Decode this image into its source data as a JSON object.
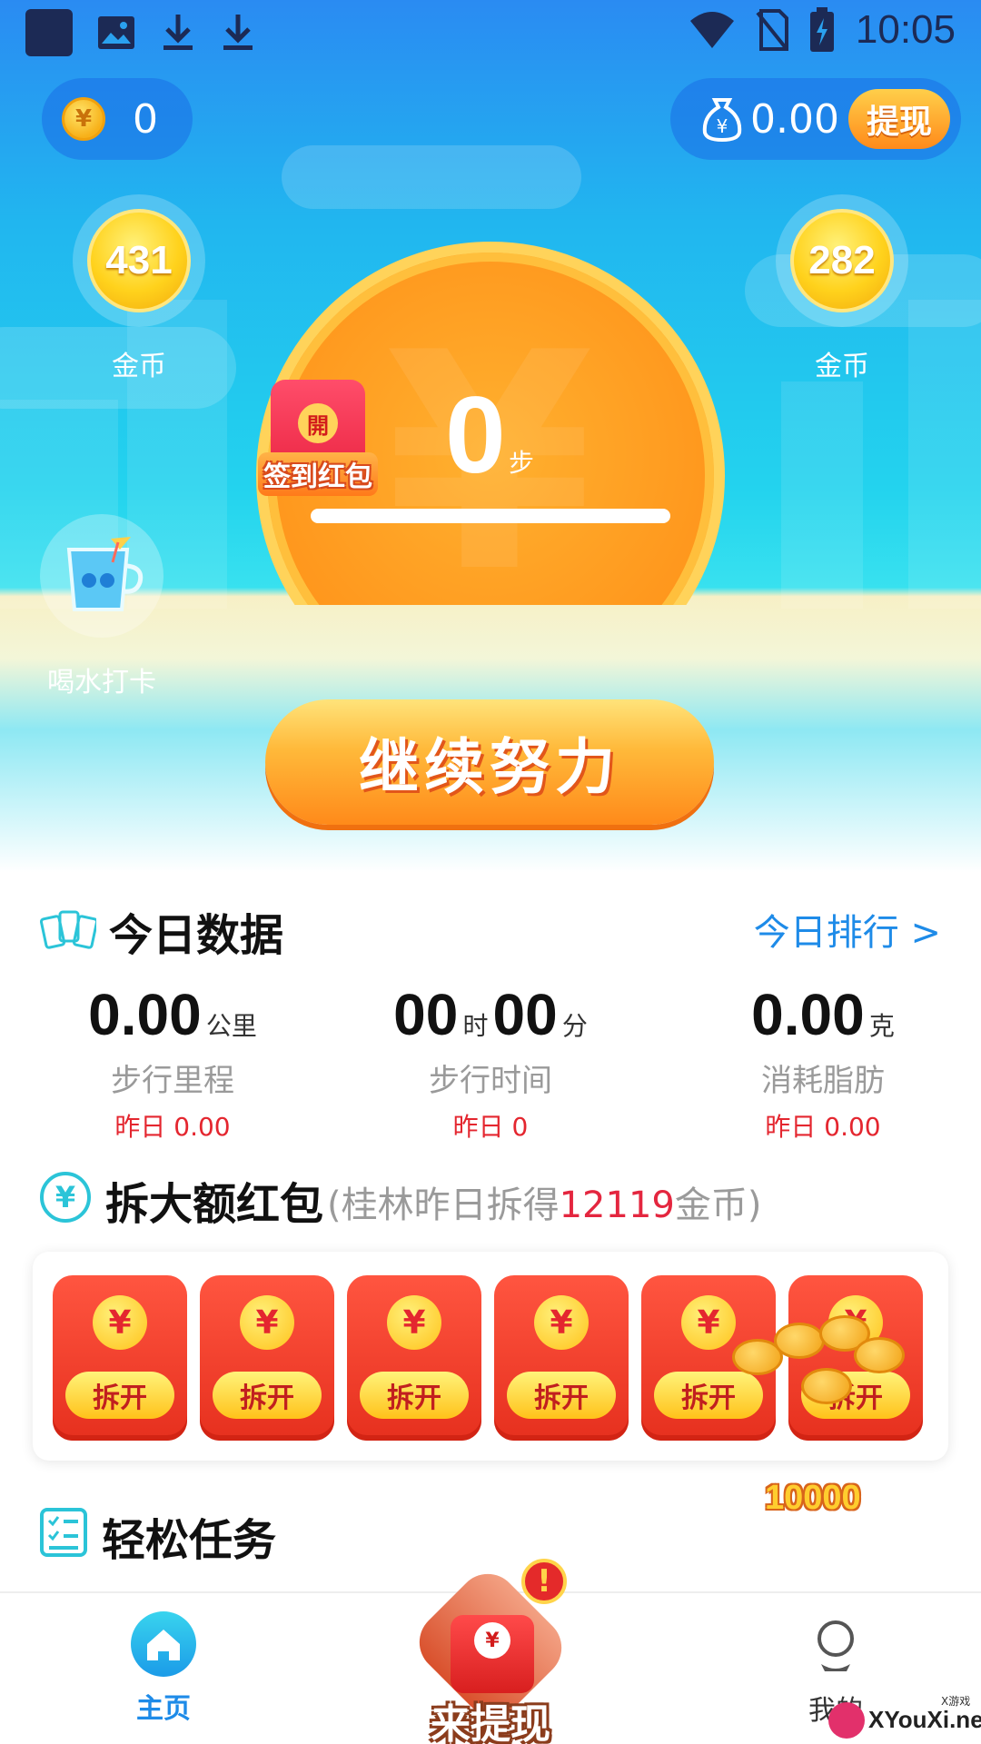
{
  "status_bar": {
    "time": "10:05"
  },
  "wallet": {
    "coins": "0",
    "cash": "0.00",
    "withdraw_label": "提现"
  },
  "bubbles": [
    {
      "value": "431",
      "label": "金币"
    },
    {
      "value": "282",
      "label": "金币"
    }
  ],
  "steps": {
    "count": "0",
    "unit": "步"
  },
  "signin": {
    "seal": "開",
    "label": "签到红包"
  },
  "water": {
    "label": "喝水打卡"
  },
  "continue_button": "继续努力",
  "today": {
    "title": "今日数据",
    "rank_link": "今日排行 >",
    "stats": [
      {
        "value": "0.00",
        "unit": "公里",
        "label": "步行里程",
        "yesterday": "昨日 0.00"
      },
      {
        "hours": "00",
        "hours_unit": "时",
        "minutes": "00",
        "minutes_unit": "分",
        "label": "步行时间",
        "yesterday": "昨日 0"
      },
      {
        "value": "0.00",
        "unit": "克",
        "label": "消耗脂肪",
        "yesterday": "昨日 0.00"
      }
    ]
  },
  "red_packets": {
    "icon_glyph": "¥",
    "title": "拆大额红包",
    "subtitle_prefix": "(桂林昨日拆得",
    "subtitle_amount": "12119",
    "subtitle_suffix": "金币)",
    "packet_glyph": "¥",
    "packet_button": "拆开",
    "bonus": "10000"
  },
  "tasks": {
    "title": "轻松任务"
  },
  "nav": {
    "home": "主页",
    "center": "来提现",
    "center_seal": "¥",
    "center_alert": "!",
    "mine": "我的"
  },
  "watermark": {
    "text": "XYouXi.net",
    "tag": "X游戏"
  }
}
